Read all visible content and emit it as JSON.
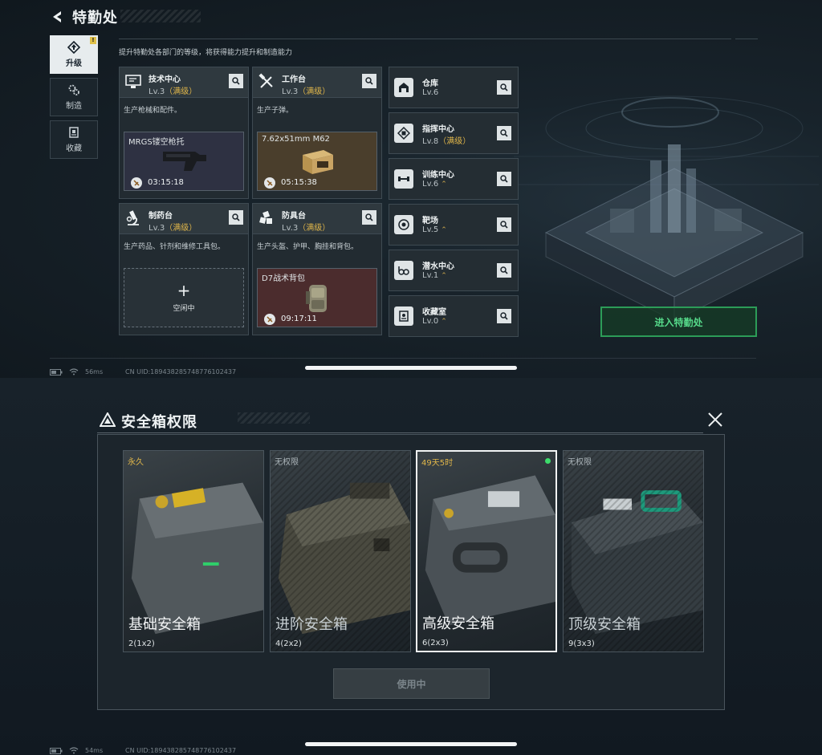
{
  "top": {
    "title": "特勤处",
    "subtitle": "提升特勤处各部门的等级，将获得能力提升和制造能力",
    "tabs": [
      {
        "label": "升级",
        "icon": "upgrade-icon",
        "active": true,
        "badge": "!"
      },
      {
        "label": "制造",
        "icon": "gear-icon",
        "active": false
      },
      {
        "label": "收藏",
        "icon": "collection-icon",
        "active": false
      }
    ],
    "workshops": [
      {
        "name": "技术中心",
        "level": "Lv.3",
        "max": "（满级）",
        "desc": "生产枪械和配件。",
        "icon": "computer-icon",
        "slot": {
          "item": "MRGS镂空枪托",
          "timer": "03:15:18"
        }
      },
      {
        "name": "工作台",
        "level": "Lv.3",
        "max": "（满级）",
        "desc": "生产子弹。",
        "icon": "tools-icon",
        "slot": {
          "item": "7.62x51mm M62",
          "timer": "05:15:38"
        }
      },
      {
        "name": "制药台",
        "level": "Lv.3",
        "max": "（满级）",
        "desc": "生产药品、针剂和维修工具包。",
        "icon": "microscope-icon",
        "empty": {
          "plus": "+",
          "label": "空闲中"
        }
      },
      {
        "name": "防具台",
        "level": "Lv.3",
        "max": "（满级）",
        "desc": "生产头盔、护甲、胸挂和背包。",
        "icon": "armor-icon",
        "slot": {
          "item": "D7战术背包",
          "timer": "09:17:11"
        }
      }
    ],
    "facilities": [
      {
        "name": "仓库",
        "level": "Lv.6",
        "suffix": "",
        "upgradable": false,
        "icon": "warehouse-icon"
      },
      {
        "name": "指挥中心",
        "level": "Lv.8",
        "suffix": "（满级）",
        "upgradable": false,
        "icon": "chip-icon"
      },
      {
        "name": "训练中心",
        "level": "Lv.6",
        "suffix": "",
        "upgradable": true,
        "icon": "dumbbell-icon"
      },
      {
        "name": "靶场",
        "level": "Lv.5",
        "suffix": "",
        "upgradable": true,
        "icon": "target-icon"
      },
      {
        "name": "潜水中心",
        "level": "Lv.1",
        "suffix": "",
        "upgradable": true,
        "icon": "diving-icon"
      },
      {
        "name": "收藏室",
        "level": "Lv.0",
        "suffix": "",
        "upgradable": true,
        "icon": "vault-icon"
      }
    ],
    "upgrade_mark": "⌃",
    "enter_button": "进入特勤处",
    "ping": "56ms",
    "uid": "CN UID:18943828574877610243​7"
  },
  "bottom": {
    "title": "安全箱权限",
    "cases": [
      {
        "status": "永久",
        "status_color": "gold",
        "name": "基础安全箱",
        "size": "2(1x2)",
        "selected": false,
        "locked": false,
        "active_dot": false
      },
      {
        "status": "无权限",
        "status_color": "grey",
        "name": "进阶安全箱",
        "size": "4(2x2)",
        "selected": false,
        "locked": true,
        "active_dot": false
      },
      {
        "status": "49天5时",
        "status_color": "gold",
        "name": "高级安全箱",
        "size": "6(2x3)",
        "selected": true,
        "locked": false,
        "active_dot": true
      },
      {
        "status": "无权限",
        "status_color": "grey",
        "name": "顶级安全箱",
        "size": "9(3x3)",
        "selected": false,
        "locked": true,
        "active_dot": false
      }
    ],
    "use_button": "使用中",
    "ping": "54ms",
    "uid": "CN UID:18943828574877610243​7"
  },
  "colors": {
    "accent_green": "#2c9c58",
    "max_gold": "#e0b64a",
    "active_dot": "#3ddc6b"
  }
}
